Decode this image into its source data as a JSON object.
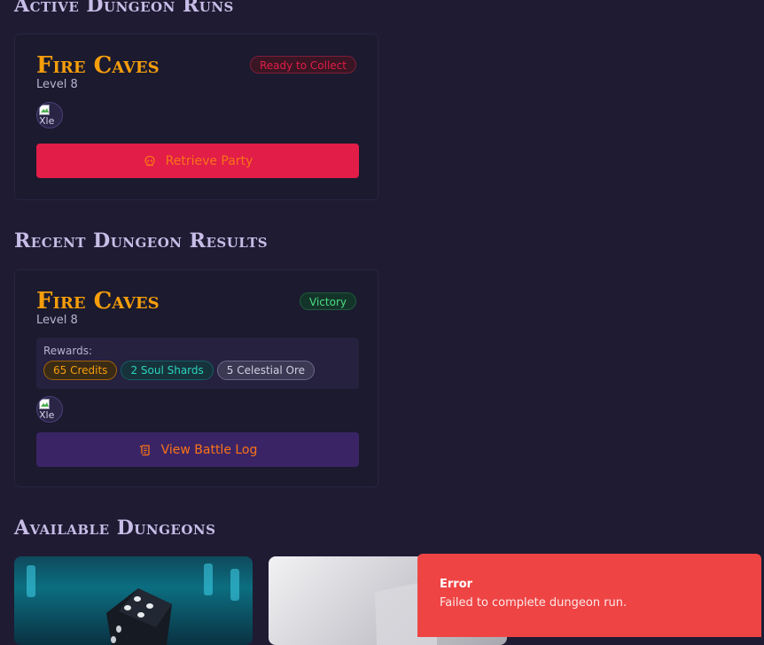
{
  "sections": {
    "active_title": "Active Dungeon Runs",
    "recent_title": "Recent Dungeon Results",
    "available_title": "Available Dungeons"
  },
  "active_run": {
    "name": "Fire Caves",
    "level": "Level 8",
    "status": "Ready to Collect",
    "avatar_alt": "Xle",
    "button_label": "Retrieve Party",
    "button_icon": "skull-icon"
  },
  "recent_result": {
    "name": "Fire Caves",
    "level": "Level 8",
    "status": "Victory",
    "rewards_label": "Rewards:",
    "rewards": [
      "65 Credits",
      "2 Soul Shards",
      "5 Celestial Ore"
    ],
    "avatar_alt": "Xle",
    "button_label": "View Battle Log",
    "button_icon": "scroll-icon"
  },
  "toast": {
    "title": "Error",
    "message": "Failed to complete dungeon run."
  },
  "colors": {
    "background": "#1f1b33",
    "accent_orange": "#f59e0b",
    "danger": "#e11d48",
    "toast": "#ef4444"
  }
}
